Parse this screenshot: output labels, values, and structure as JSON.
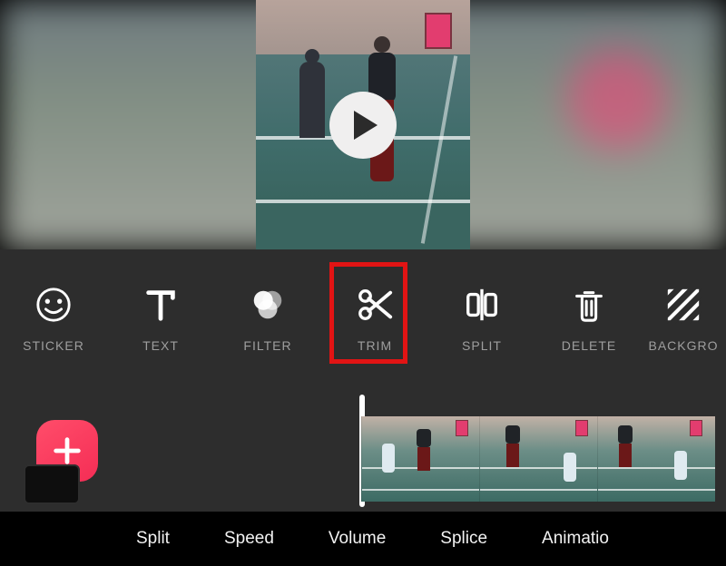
{
  "toolbar": [
    {
      "id": "sticker",
      "label": "STICKER"
    },
    {
      "id": "text",
      "label": "TEXT"
    },
    {
      "id": "filter",
      "label": "FILTER"
    },
    {
      "id": "trim",
      "label": "TRIM"
    },
    {
      "id": "split",
      "label": "SPLIT"
    },
    {
      "id": "delete",
      "label": "DELETE"
    },
    {
      "id": "background",
      "label": "BACKGRO"
    }
  ],
  "highlighted_tool": "trim",
  "bottom": [
    {
      "id": "split",
      "label": "Split"
    },
    {
      "id": "speed",
      "label": "Speed"
    },
    {
      "id": "volume",
      "label": "Volume"
    },
    {
      "id": "splice",
      "label": "Splice"
    },
    {
      "id": "animation",
      "label": "Animatio"
    }
  ],
  "colors": {
    "highlight": "#e11414",
    "accent": "#f52d55"
  }
}
